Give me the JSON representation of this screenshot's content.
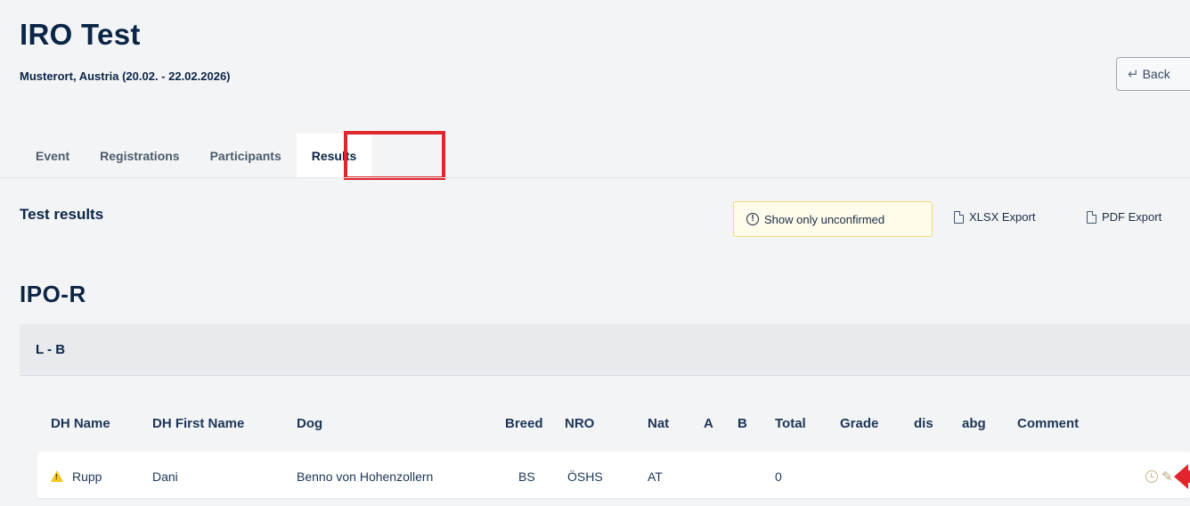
{
  "header": {
    "title": "IRO Test",
    "subtitle": "Musterort, Austria (20.02. - 22.02.2026)",
    "back_label": "Back"
  },
  "tabs": [
    {
      "label": "Event"
    },
    {
      "label": "Registrations"
    },
    {
      "label": "Participants"
    },
    {
      "label": "Results",
      "active": true
    }
  ],
  "results_section": {
    "title": "Test results",
    "unconfirmed_label": "Show only unconfirmed",
    "xlsx_label": "XLSX Export",
    "pdf_label": "PDF Export"
  },
  "group": {
    "title": "IPO-R",
    "class_label": "L - B"
  },
  "table": {
    "columns": [
      "DH Name",
      "DH First Name",
      "Dog",
      "Breed",
      "NRO",
      "Nat",
      "A",
      "B",
      "Total",
      "Grade",
      "dis",
      "abg",
      "Comment"
    ],
    "rows": [
      {
        "dh_name": "Rupp",
        "dh_first_name": "Dani",
        "dog": "Benno von Hohenzollern",
        "breed": "BS",
        "nro": "ÖSHS",
        "nat": "AT",
        "a": "",
        "b": "",
        "total": "0",
        "grade": "",
        "dis": "",
        "abg": "",
        "comment": "",
        "warning": true
      }
    ]
  },
  "colors": {
    "accent_red": "#e0262c",
    "warning_yellow": "#f3c620",
    "title_navy": "#0b2547"
  },
  "icons": {
    "back": "return-arrow-icon",
    "info": "info-circle-icon",
    "xlsx": "xlsx-file-icon",
    "pdf": "pdf-file-icon",
    "warning": "warning-triangle-icon",
    "history": "clock-icon",
    "edit": "pencil-icon"
  }
}
